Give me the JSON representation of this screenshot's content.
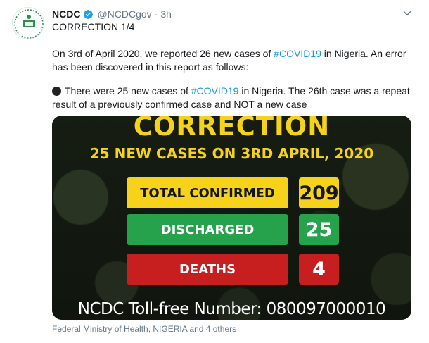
{
  "tweet": {
    "author_name": "NCDC",
    "verified_icon": "verified-badge-icon",
    "handle": "@NCDCgov",
    "separator": "·",
    "time": "3h",
    "menu_icon": "chevron-down-icon",
    "line1": "CORRECTION 1/4",
    "para1_line1_pre": "On 3rd of April 2020, we reported 26 new cases of ",
    "hashtag1": "#COVID19",
    "para1_line1_post": " in Nigeria. An error",
    "para1_line2": "has been discovered in this report as follows:",
    "bullet_icon": "black-circle-icon",
    "para2_line1_pre": "There were 25 new cases of ",
    "hashtag2": "#COVID19",
    "para2_line1_post": " in Nigeria. The 26th case was a repeat",
    "para2_line2": "result of a previously confirmed case and NOT a new case",
    "tagged_text": "Federal Ministry of Health, NIGERIA and 4 others"
  },
  "media": {
    "title": "CORRECTION",
    "subtitle": "25 NEW CASES ON 3RD APRIL, 2020",
    "rows": [
      {
        "label": "TOTAL CONFIRMED",
        "value": "209",
        "color": "#f6d21a"
      },
      {
        "label": "DISCHARGED",
        "value": "25",
        "color": "#27a24c"
      },
      {
        "label": "DEATHS",
        "value": "4",
        "color": "#c71f1f"
      }
    ],
    "tollfree": "NCDC Toll-free Number: 080097000010"
  },
  "colors": {
    "link": "#1b95e0",
    "secondary_text": "#657786",
    "verified": "#1da1f2"
  }
}
